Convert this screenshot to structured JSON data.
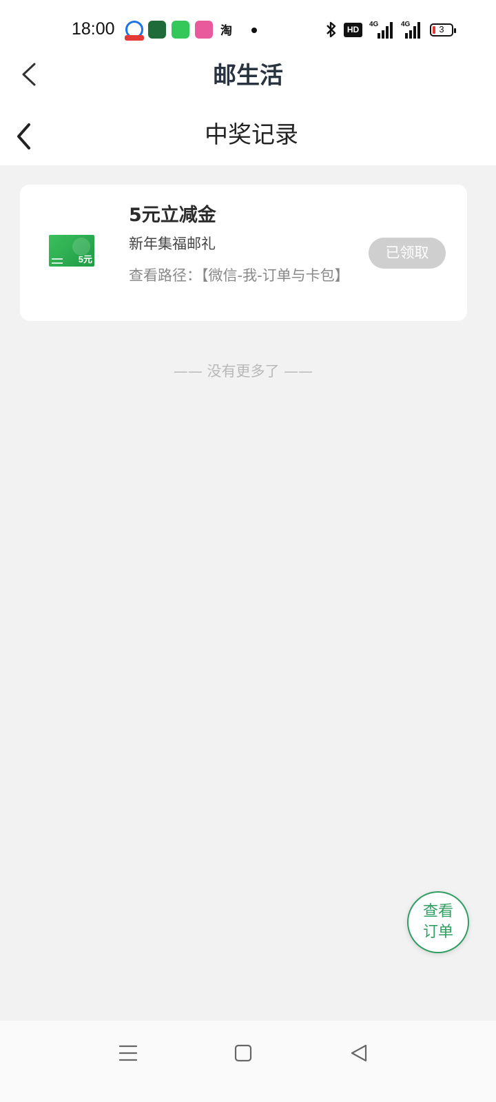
{
  "status_bar": {
    "time": "18:00",
    "taobao_label": "淘",
    "hd_label": "HD",
    "network_1": "4G",
    "network_2": "4G",
    "battery": "3"
  },
  "app_header": {
    "title": "邮生活"
  },
  "page_header": {
    "title": "中奖记录"
  },
  "prize": {
    "title": "5元立减金",
    "subtitle": "新年集福邮礼",
    "path": "查看路径：【微信-我-订单与卡包】",
    "thumb_amount": "5元",
    "status_button": "已领取"
  },
  "list_footer": "—— 没有更多了 ——",
  "fab": {
    "line1": "查看",
    "line2": "订单"
  },
  "colors": {
    "accent_green": "#2f9e60",
    "card_bg": "#ffffff",
    "page_bg": "#f2f2f2",
    "claimed_grey": "#cfcfcf"
  }
}
